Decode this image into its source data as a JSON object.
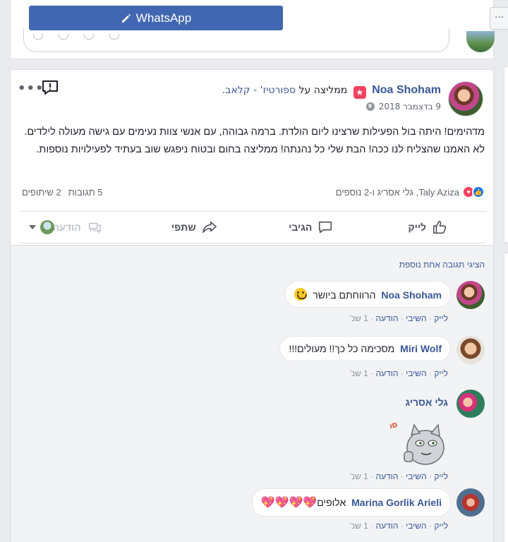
{
  "top_card": {
    "whatsapp_label": "WhatsApp"
  },
  "side": {
    "more_label": "···"
  },
  "post": {
    "author": "Noa Shoham",
    "recommends_text": "ממליצה על",
    "recommends_page": "ספורטיז' - קלאב.",
    "date": "9 בדצמבר 2018",
    "text": "מדהימים! היתה בול הפעילות שרצינו ליום הולדת. ברמה גבוהה, עם אנשי צוות נעימים עם גישה מעולה לילדים. לא האמנו שהצליח לנו ככה! הבת שלי כל נהנתה! ממליצה בחום ובטוח ניפגש שוב בעתיד לפעילויות נוספות.",
    "more_label": "•••",
    "reactions_text": "Taly Aziza, גלי אסריג ו-2 נוספים",
    "comments_count": "5 תגובות",
    "shares_count": "2 שיתופים",
    "actions": {
      "like": "לייק",
      "comment": "הגיבי",
      "share": "שתפי",
      "message": "הודעה"
    },
    "more_replies": "הציגי תגובה אחת נוספת"
  },
  "comments": [
    {
      "name": "Noa Shoham",
      "text": "הרווחתם ביושר",
      "actions": {
        "like": "לייק",
        "reply": "השיבי",
        "message": "הודעה",
        "time": "1 שנ'"
      }
    },
    {
      "name": "Miri Wolf",
      "text": "מסכימה כל כך!! מעולים!!!",
      "actions": {
        "like": "לייק",
        "reply": "השיבי",
        "message": "הודעה",
        "time": "1 שנ'"
      }
    },
    {
      "name": "גלי אסריג",
      "text": "",
      "sticker_text": "GOOD!",
      "actions": {
        "like": "לייק",
        "reply": "השיבי",
        "message": "הודעה",
        "time": "1 שנ'"
      }
    },
    {
      "name": "Marina Gorlik Arieli",
      "text": "אלופים",
      "hearts": "💖💖💖💖",
      "actions": {
        "like": "לייק",
        "reply": "השיבי",
        "message": "הודעה",
        "time": "1 שנ'"
      }
    }
  ],
  "colors": {
    "brand": "#4267b2",
    "link": "#385898",
    "love": "#f33e58",
    "like": "#1877f2"
  }
}
